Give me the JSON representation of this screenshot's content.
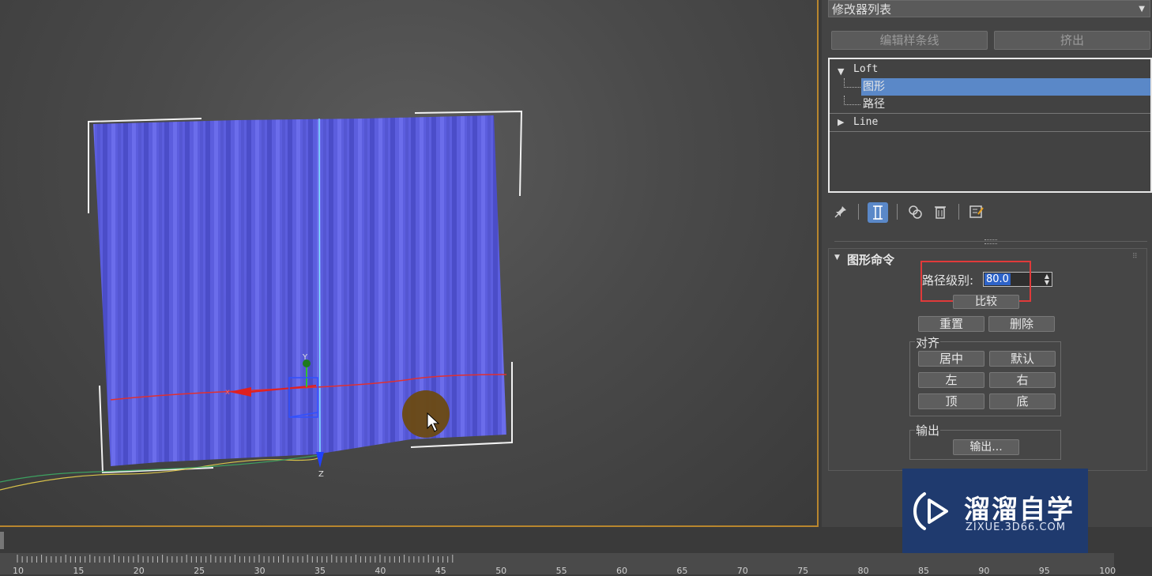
{
  "modifier_list": {
    "label": "修改器列表"
  },
  "top_buttons": {
    "edit_spline": "编辑样条线",
    "extrude": "挤出"
  },
  "stack": {
    "loft": "Loft",
    "shape": "图形",
    "path": "路径",
    "line": "Line"
  },
  "rollout": {
    "title": "图形命令",
    "path_level_label": "路径级别:",
    "path_level_value": "80.0",
    "compare": "比较",
    "reset": "重置",
    "delete": "删除",
    "align_group": "对齐",
    "center": "居中",
    "default": "默认",
    "left": "左",
    "right": "右",
    "top": "顶",
    "bottom": "底",
    "output_group": "输出",
    "output_button": "输出..."
  },
  "watermark": {
    "title": "溜溜自学",
    "url": "ZIXUE.3D66.COM"
  },
  "viewport": {
    "axis_x": "x",
    "axis_y": "Y",
    "axis_z": "Z"
  },
  "timeline": {
    "ticks": [
      "10",
      "15",
      "20",
      "25",
      "30",
      "35",
      "40",
      "45",
      "50",
      "55",
      "60",
      "65",
      "70",
      "75",
      "80",
      "85",
      "90",
      "95",
      "100"
    ]
  },
  "colors": {
    "accent_select": "#5a88c8",
    "highlight_box": "#e03a3a",
    "curtain": "#5d5ee0",
    "viewport_border": "#b8862e"
  }
}
